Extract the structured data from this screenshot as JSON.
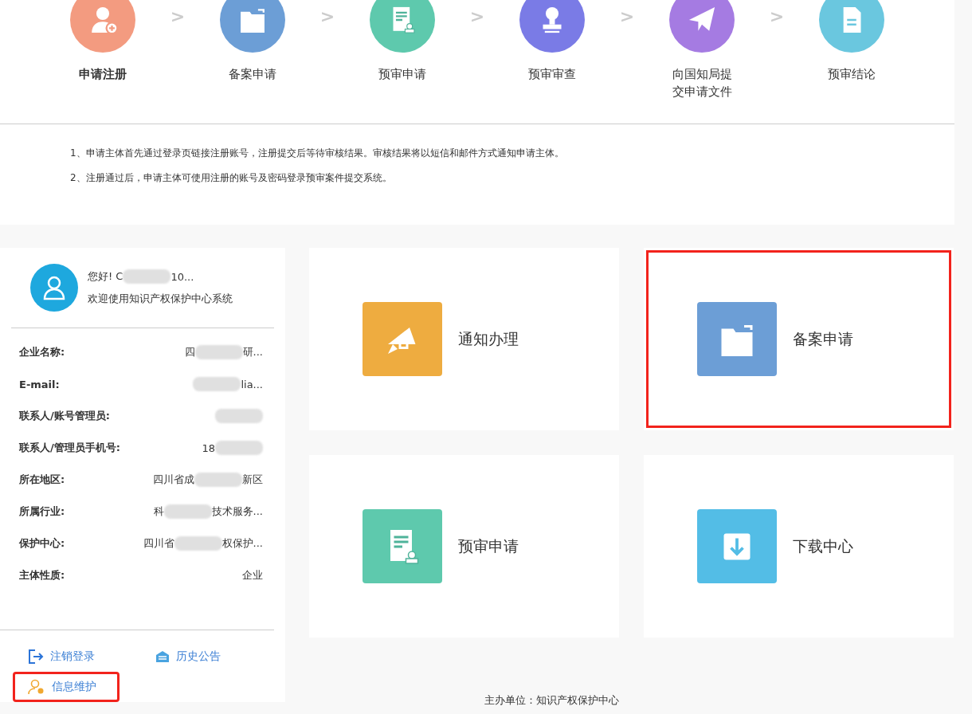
{
  "steps": [
    {
      "label": "申请注册",
      "color": "#f39b80",
      "selected": true
    },
    {
      "label": "备案申请",
      "color": "#6c9ed6",
      "selected": false
    },
    {
      "label": "预审申请",
      "color": "#5ec9ad",
      "selected": false
    },
    {
      "label": "预审审查",
      "color": "#7a7be6",
      "selected": false
    },
    {
      "label": "向国知局提交申请文件",
      "color": "#a57be2",
      "selected": false
    },
    {
      "label": "预审结论",
      "color": "#6ac7df",
      "selected": false
    }
  ],
  "step_separator": ">",
  "notes": [
    "1、申请主体首先通过登录页链接注册账号，注册提交后等待审核结果。审核结果将以短信和邮件方式通知申请主体。",
    "2、注册通过后，申请主体可使用注册的账号及密码登录预审案件提交系统。"
  ],
  "profile": {
    "greeting_start": "您好! C",
    "greeting_end": "10...",
    "welcome": "欢迎使用知识产权保护中心系统",
    "fields": [
      {
        "label": "企业名称:",
        "value_start": "四",
        "value_end": "研...",
        "redacted": true
      },
      {
        "label": "E-mail:",
        "value_end": "lia...",
        "redacted": true
      },
      {
        "label": "联系人/账号管理员:",
        "redacted": true
      },
      {
        "label": "联系人/管理员手机号:",
        "value_start": "18",
        "redacted": true
      },
      {
        "label": "所在地区:",
        "value_start": "四川省成",
        "value_end": "新区",
        "redacted": true
      },
      {
        "label": "所属行业:",
        "value_start": "科",
        "value_end": "技术服务...",
        "redacted": true
      },
      {
        "label": "保护中心:",
        "value_start": "四川省",
        "value_end": "权保护...",
        "redacted": true
      },
      {
        "label": "主体性质:",
        "value_start": "企业",
        "redacted": false
      }
    ],
    "actions": [
      {
        "label": "注销登录",
        "kind": "logout",
        "highlighted": false
      },
      {
        "label": "历史公告",
        "kind": "notice",
        "highlighted": false
      },
      {
        "label": "信息维护",
        "kind": "profile",
        "highlighted": true
      }
    ]
  },
  "tiles": [
    {
      "label": "通知办理",
      "color": "#eeac40",
      "highlighted": false
    },
    {
      "label": "备案申请",
      "color": "#6c9ed6",
      "highlighted": true
    },
    {
      "label": "预审申请",
      "color": "#5ec9ad",
      "highlighted": false
    },
    {
      "label": "下载中心",
      "color": "#53bde6",
      "highlighted": false
    }
  ],
  "footer": "主办单位：知识产权保护中心"
}
